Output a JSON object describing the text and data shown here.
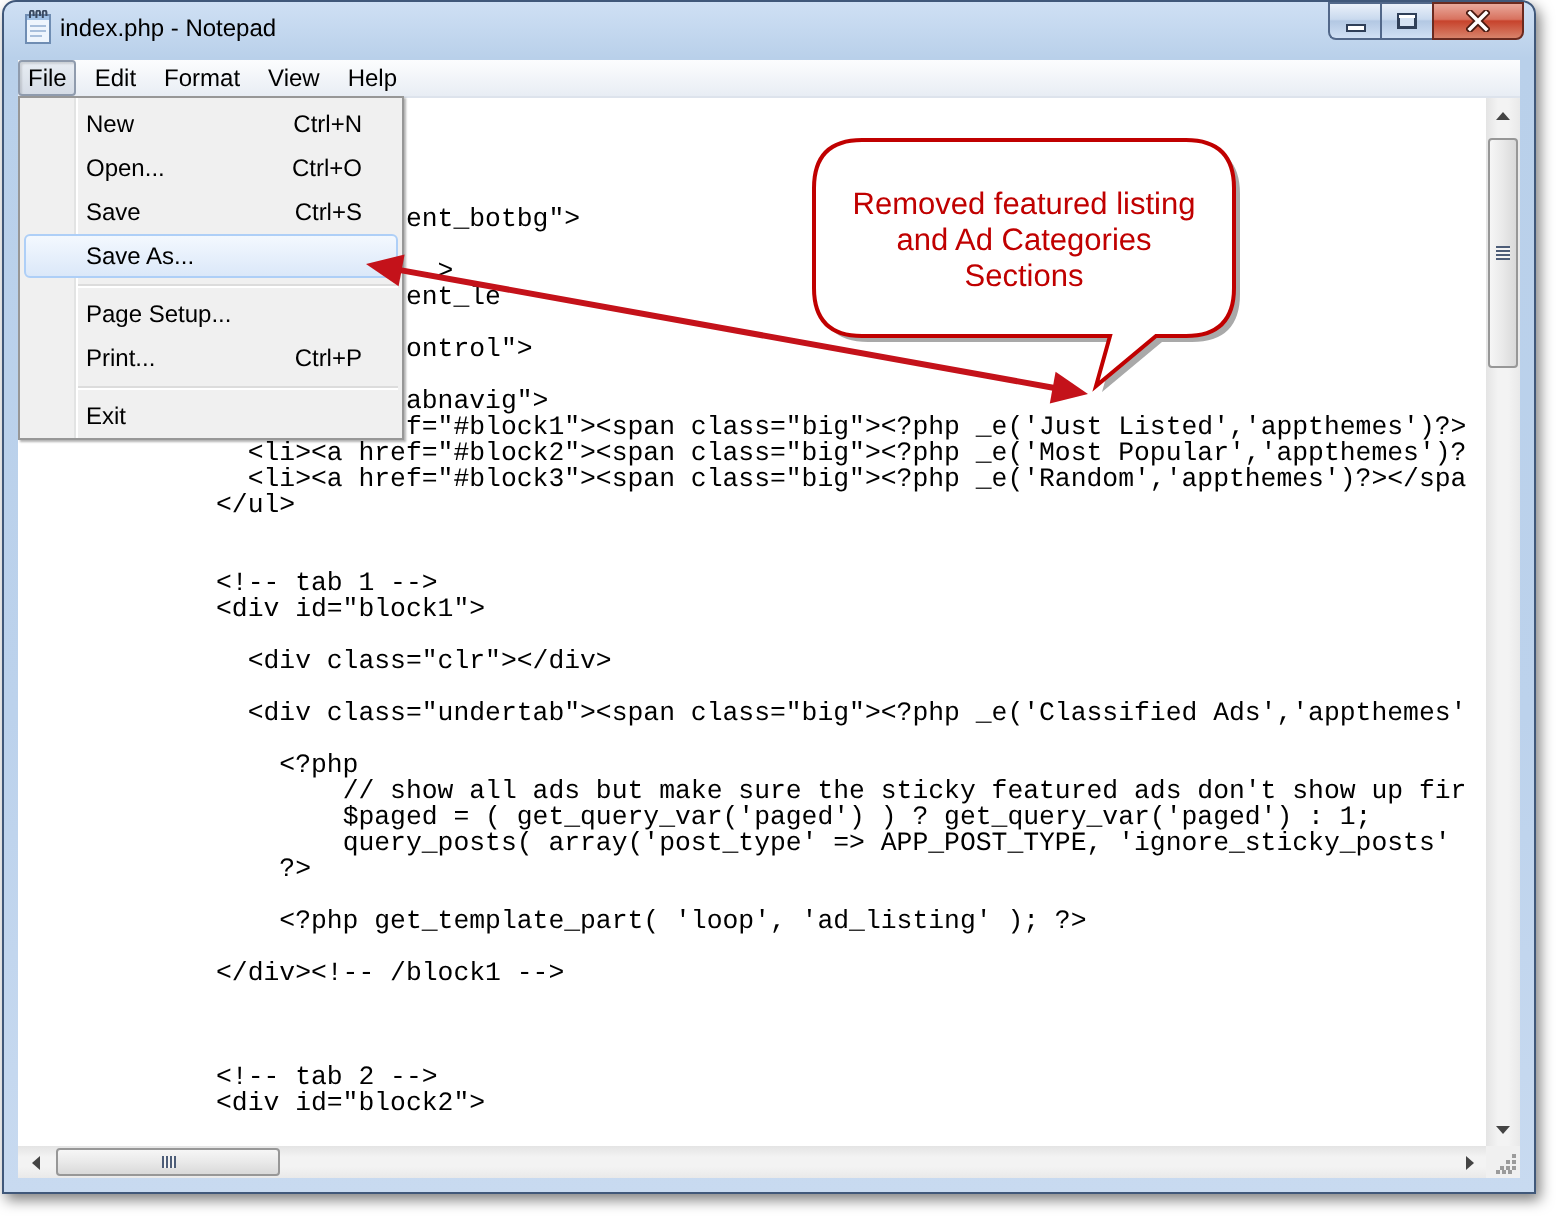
{
  "window": {
    "title": "index.php - Notepad"
  },
  "menu_bar": [
    {
      "label": "File",
      "selected": true
    },
    {
      "label": "Edit",
      "selected": false
    },
    {
      "label": "Format",
      "selected": false
    },
    {
      "label": "View",
      "selected": false
    },
    {
      "label": "Help",
      "selected": false
    }
  ],
  "file_menu": [
    {
      "kind": "item",
      "label": "New",
      "shortcut": "Ctrl+N",
      "selected": false
    },
    {
      "kind": "item",
      "label": "Open...",
      "shortcut": "Ctrl+O",
      "selected": false
    },
    {
      "kind": "item",
      "label": "Save",
      "shortcut": "Ctrl+S",
      "selected": false
    },
    {
      "kind": "item",
      "label": "Save As...",
      "selected": true
    },
    {
      "kind": "separator"
    },
    {
      "kind": "item",
      "label": "Page Setup...",
      "selected": false
    },
    {
      "kind": "item",
      "label": "Print...",
      "shortcut": "Ctrl+P",
      "selected": false
    },
    {
      "kind": "separator"
    },
    {
      "kind": "item",
      "label": "Exit",
      "selected": false
    }
  ],
  "editor": {
    "lines": [
      {
        "kind": "blank"
      },
      {
        "kind": "blank"
      },
      {
        "kind": "blank"
      },
      {
        "kind": "blank"
      },
      {
        "kind": "code",
        "text": "            ent_botbg\">"
      },
      {
        "kind": "blank"
      },
      {
        "kind": "code",
        "text": "              >"
      },
      {
        "kind": "code",
        "text": "            ent_le"
      },
      {
        "kind": "blank"
      },
      {
        "kind": "code",
        "text": "            ontrol\">"
      },
      {
        "kind": "blank"
      },
      {
        "kind": "code",
        "text": "            abnavig\">"
      },
      {
        "kind": "code",
        "text": "            f=\"#block1\"><span class=\"big\"><?php _e('Just Listed','appthemes')?>"
      },
      {
        "kind": "code",
        "text": "  <li><a href=\"#block2\"><span class=\"big\"><?php _e('Most Popular','appthemes')?"
      },
      {
        "kind": "code",
        "text": "  <li><a href=\"#block3\"><span class=\"big\"><?php _e('Random','appthemes')?></spa"
      },
      {
        "kind": "code",
        "text": "</ul>"
      },
      {
        "kind": "blank"
      },
      {
        "kind": "blank"
      },
      {
        "kind": "code",
        "text": "<!-- tab 1 -->"
      },
      {
        "kind": "code",
        "text": "<div id=\"block1\">"
      },
      {
        "kind": "blank"
      },
      {
        "kind": "code",
        "text": "  <div class=\"clr\"></div>"
      },
      {
        "kind": "blank"
      },
      {
        "kind": "code",
        "text": "  <div class=\"undertab\"><span class=\"big\"><?php _e('Classified Ads','appthemes'"
      },
      {
        "kind": "blank"
      },
      {
        "kind": "code",
        "text": "    <?php"
      },
      {
        "kind": "code",
        "text": "        // show all ads but make sure the sticky featured ads don't show up fir"
      },
      {
        "kind": "code",
        "text": "        $paged = ( get_query_var('paged') ) ? get_query_var('paged') : 1;"
      },
      {
        "kind": "code",
        "text": "        query_posts( array('post_type' => APP_POST_TYPE, 'ignore_sticky_posts'"
      },
      {
        "kind": "code",
        "text": "    ?>"
      },
      {
        "kind": "blank"
      },
      {
        "kind": "code",
        "text": "    <?php get_template_part( 'loop', 'ad_listing' ); ?>"
      },
      {
        "kind": "blank"
      },
      {
        "kind": "code",
        "text": "</div><!-- /block1 -->"
      },
      {
        "kind": "blank"
      },
      {
        "kind": "blank"
      },
      {
        "kind": "blank"
      },
      {
        "kind": "code",
        "text": "<!-- tab 2 -->"
      },
      {
        "kind": "code",
        "text": "<div id=\"block2\">"
      }
    ]
  },
  "callout": {
    "text": "Removed featured listing\nand Ad Categories\nSections"
  }
}
